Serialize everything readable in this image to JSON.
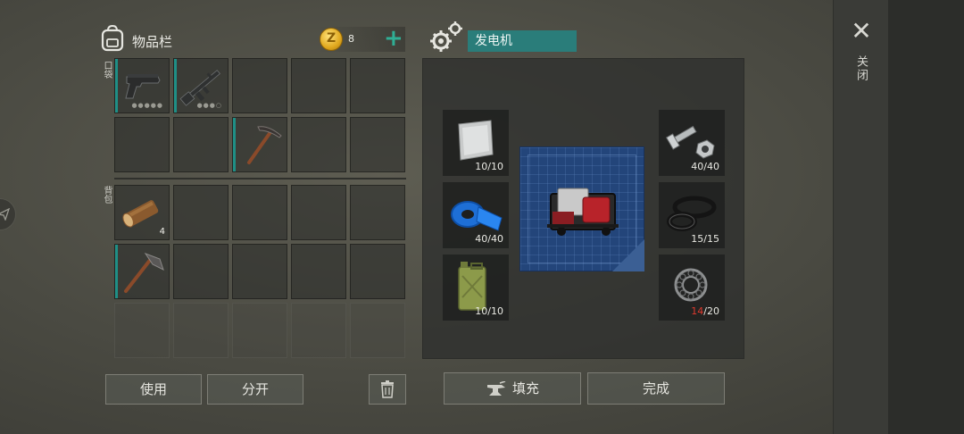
{
  "inventory": {
    "title": "物品栏",
    "coins": "8",
    "plus": "+",
    "pocket_label": "口袋",
    "backpack_label": "背包",
    "pocket_slots": [
      {
        "item": "pistol",
        "count": ""
      },
      {
        "item": "assault-rifle",
        "count": ""
      },
      {
        "item": "",
        "count": ""
      },
      {
        "item": "",
        "count": ""
      },
      {
        "item": "",
        "count": ""
      },
      {
        "item": "",
        "count": ""
      },
      {
        "item": "",
        "count": ""
      },
      {
        "item": "pickaxe",
        "count": ""
      },
      {
        "item": "",
        "count": ""
      },
      {
        "item": "",
        "count": ""
      }
    ],
    "backpack_slots": [
      {
        "item": "log",
        "count": "4"
      },
      {
        "item": "",
        "count": ""
      },
      {
        "item": "",
        "count": ""
      },
      {
        "item": "",
        "count": ""
      },
      {
        "item": "",
        "count": ""
      },
      {
        "item": "hatchet",
        "count": ""
      },
      {
        "item": "",
        "count": ""
      },
      {
        "item": "",
        "count": ""
      },
      {
        "item": "",
        "count": ""
      },
      {
        "item": "",
        "count": ""
      }
    ],
    "buttons": {
      "use": "使用",
      "split": "分开"
    }
  },
  "crafting": {
    "title": "发电机",
    "blueprint_item": "generator",
    "materials_left": [
      {
        "name": "metal-sheet",
        "have": "10",
        "need": "10"
      },
      {
        "name": "tape",
        "have": "40",
        "need": "40"
      },
      {
        "name": "jerrycan",
        "have": "10",
        "need": "10"
      }
    ],
    "materials_right": [
      {
        "name": "bolts-nuts",
        "have": "40",
        "need": "40"
      },
      {
        "name": "rubber-seals",
        "have": "15",
        "need": "15"
      },
      {
        "name": "bearing",
        "have": "14",
        "need": "20"
      }
    ],
    "buttons": {
      "fill": "填充",
      "complete": "完成"
    }
  },
  "close": {
    "x": "✕",
    "label": "关闭"
  },
  "colors": {
    "accent_teal": "#2a7d7a",
    "shortage_red": "#e03a2e",
    "coin_gold": "#e0a81e"
  }
}
